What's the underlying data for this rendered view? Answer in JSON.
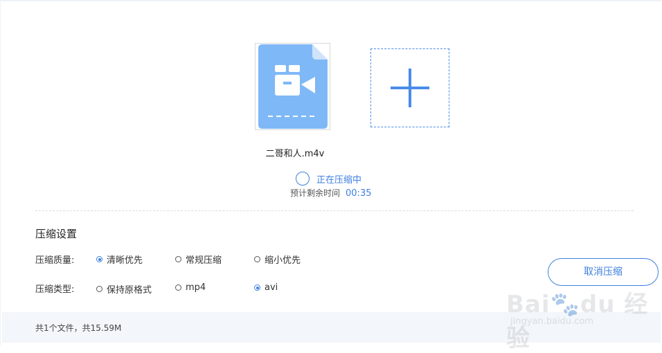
{
  "file": {
    "name": "二哥和人.m4v",
    "icon": "video-file-icon"
  },
  "add_button": {
    "icon": "plus-icon"
  },
  "progress": {
    "status_text": "正在压缩中",
    "remaining_label": "预计剩余时间",
    "remaining_time": "00:35"
  },
  "settings": {
    "title": "压缩设置",
    "quality": {
      "label": "压缩质量:",
      "options": [
        "清晰优先",
        "常规压缩",
        "缩小优先"
      ],
      "selected": "清晰优先"
    },
    "type": {
      "label": "压缩类型:",
      "options": [
        "保持原格式",
        "mp4",
        "avi"
      ],
      "selected": "avi"
    }
  },
  "cancel_button": {
    "label": "取消压缩"
  },
  "footer": {
    "summary": "共1个文件，共15.59M"
  },
  "watermark": {
    "logo": "Bai du 经验",
    "url": "jingyan.baidu.com"
  },
  "colors": {
    "accent": "#3d7fe0",
    "file_icon": "#7fb8f7",
    "footer_bg": "#f3f6fa"
  }
}
